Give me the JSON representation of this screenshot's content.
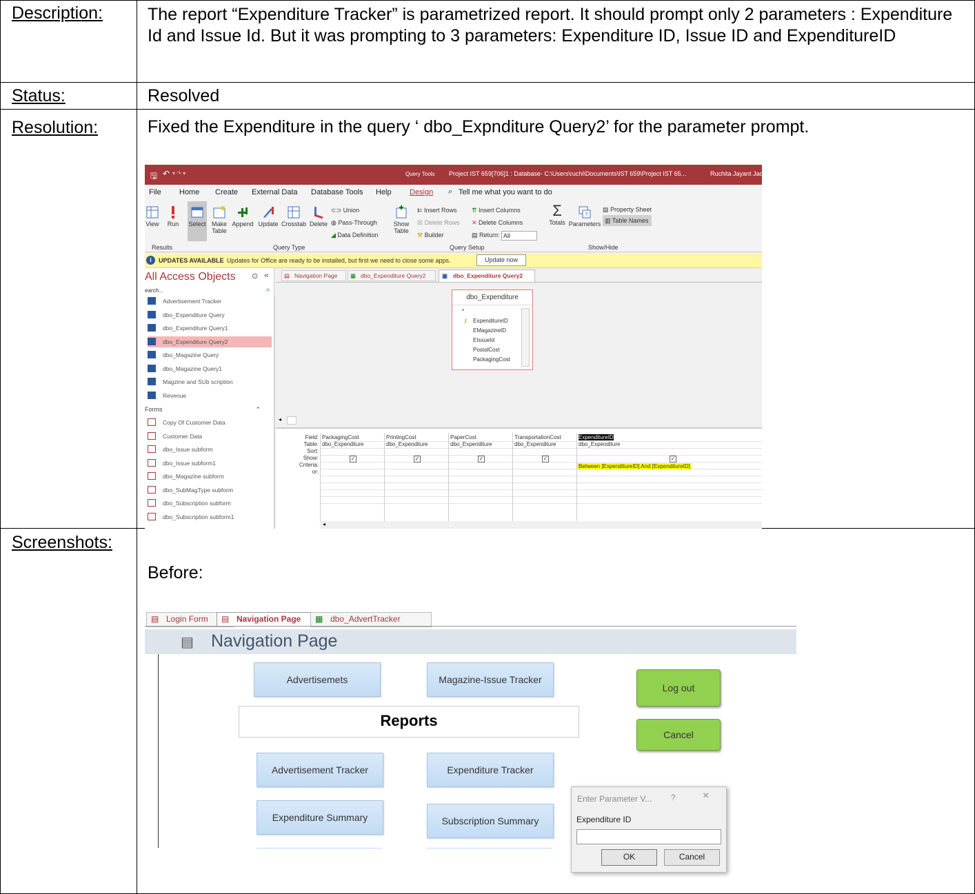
{
  "table": {
    "description_label": "Description:",
    "description_text": "The report “Expenditure Tracker” is parametrized report. It should prompt only 2 parameters : Expenditure Id and Issue Id. But it was prompting to 3 parameters: Expenditure ID, Issue ID and ExpenditureID",
    "status_label": "Status:",
    "status_text": "Resolved",
    "resolution_label": "Resolution:",
    "resolution_text": "Fixed the Expenditure in the query ‘ dbo_Expnditure Query2’ for the parameter prompt.",
    "screenshots_label": "Screenshots:",
    "before_label": "Before:"
  },
  "access": {
    "title_context": "Query Tools",
    "title_text": "Project IST 659[706]1 : Database- C:\\Users\\ruchi\\Documents\\IST 659\\Project IST 65...",
    "user": "Ruchita Jayant Jad",
    "ribbon_tabs": [
      "File",
      "Home",
      "Create",
      "External Data",
      "Database Tools",
      "Help",
      "Design"
    ],
    "tell_me": "Tell me what you want to do",
    "results_buttons": {
      "view": "View",
      "run": "Run"
    },
    "query_type_buttons": {
      "select": "Select",
      "make_table": "Make Table",
      "append": "Append",
      "update": "Update",
      "crosstab": "Crosstab",
      "delete": "Delete"
    },
    "query_type_small": [
      "Union",
      "Pass-Through",
      "Data Definition"
    ],
    "setup_show_table": "Show Table",
    "setup_small": [
      "Insert Rows",
      "Delete Rows",
      "Builder"
    ],
    "setup_small2": [
      "Insert Columns",
      "Delete Columns",
      "Return:"
    ],
    "return_value": "All",
    "showhide_buttons": {
      "totals": "Totals",
      "parameters": "Parameters"
    },
    "showhide_small": [
      "Property Sheet",
      "Table Names"
    ],
    "group_labels": [
      "Results",
      "Query Type",
      "Query Setup",
      "Show/Hide"
    ],
    "update_title": "UPDATES AVAILABLE",
    "update_msg": "Updates for Office are ready to be installed, but first we need to close some apps.",
    "update_btn": "Update now",
    "nav_title": "All Access Objects",
    "nav_search_placeholder": "earch...",
    "nav_items": [
      "Advertisement Tracker",
      "dbo_Expenditure Query",
      "dbo_Expenditure Query1",
      "dbo_Expenditure Query2",
      "dbo_Magazine Query",
      "dbo_Magazine Query1",
      "Magzine and SUb scription",
      "Revenue"
    ],
    "nav_forms_header": "Forms",
    "nav_forms": [
      "Copy Of Customer Data",
      "Customer Data",
      "dbo_Issue subform",
      "dbo_Issue subform1",
      "dbo_Magazine subform",
      "dbo_SubMagType subform",
      "dbo_Subscription subform",
      "dbo_Subscription subform1"
    ],
    "doc_tabs": [
      "Navigation Page",
      "dbo_Expenditure Query2",
      "dbo_Expenditure Query2"
    ],
    "table_box_title": "dbo_Expenditure",
    "table_fields": [
      "*",
      "ExpenditureID",
      "EMagazineID",
      "EIssueId",
      "PostalCost",
      "PackagingCost"
    ],
    "grid_row_labels": [
      "Field:",
      "Table:",
      "Sort:",
      "Show:",
      "Criteria:",
      "or:"
    ],
    "grid_fields": [
      "PackagingCost",
      "PrintingCost",
      "PaperCost",
      "TransportationCost",
      "ExpenditureID"
    ],
    "grid_tables": [
      "dbo_Expenditure",
      "dbo_Expenditure",
      "dbo_Expenditure",
      "dbo_Expenditure",
      "dbo_Expenditure"
    ],
    "grid_criteria": "Between [ExpenditureID] And [ExpenditureID]"
  },
  "navpage": {
    "tabs": [
      "Login Form",
      "Navigation Page",
      "dbo_AdvertTracker"
    ],
    "title": "Navigation Page",
    "btn_advertisements": "Advertisemets",
    "btn_magazine_issue": "Magazine-Issue Tracker",
    "reports_heading": "Reports",
    "btn_advert_tracker": "Advertisement Tracker",
    "btn_expenditure_tracker": "Expenditure Tracker",
    "btn_expenditure_summary": "Expenditure Summary",
    "btn_subscription_summary": "Subscription Summary",
    "btn_logout": "Log out",
    "btn_cancel": "Cancel",
    "dialog_title": "Enter Parameter V...",
    "dialog_help": "?",
    "dialog_close": "×",
    "dialog_prompt": "Expenditure ID",
    "dialog_ok": "OK",
    "dialog_cancel": "Cancel"
  },
  "colors": {
    "access_red": "#a4373a",
    "update_yellow": "#fff7a1",
    "selected_nav": "#f4b6b6",
    "criteria_highlight": "#ffff00",
    "green_button": "#92d050"
  }
}
